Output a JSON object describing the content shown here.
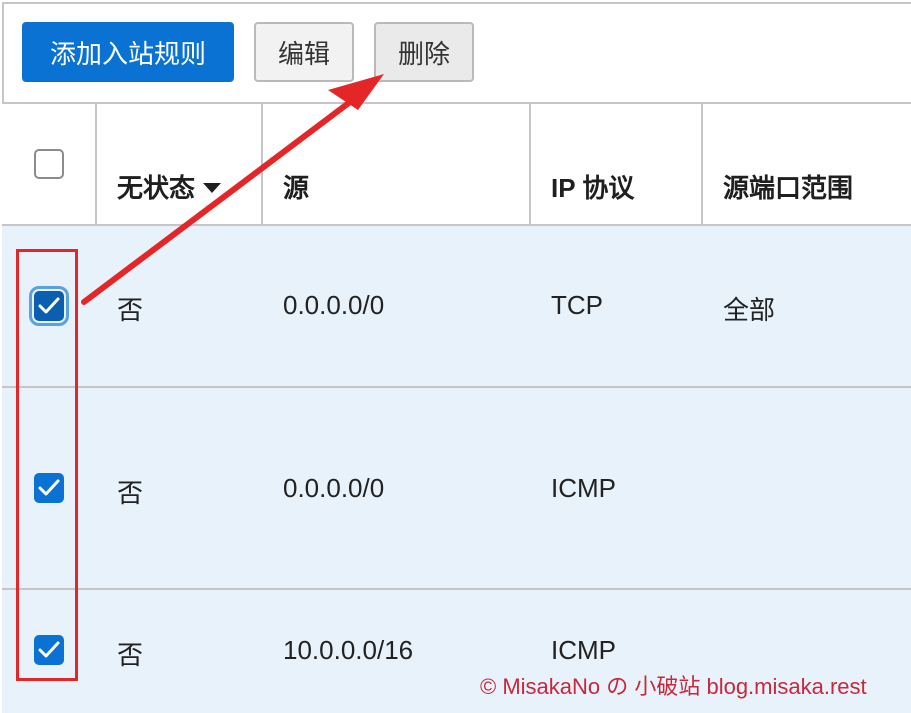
{
  "toolbar": {
    "add_rule_label": "添加入站规则",
    "edit_label": "编辑",
    "delete_label": "删除"
  },
  "table": {
    "columns": [
      "无状态",
      "源",
      "IP 协议",
      "源端口范围"
    ],
    "rows": [
      {
        "selected": true,
        "stateless": "否",
        "source": "0.0.0.0/0",
        "protocol": "TCP",
        "port_range": "全部"
      },
      {
        "selected": true,
        "stateless": "否",
        "source": "0.0.0.0/0",
        "protocol": "ICMP",
        "port_range": ""
      },
      {
        "selected": true,
        "stateless": "否",
        "source": "10.0.0.0/16",
        "protocol": "ICMP",
        "port_range": ""
      }
    ]
  },
  "icons": {
    "checkbox": "checkmark-icon",
    "sort": "caret-down-icon",
    "annotation": "red-arrow-annotation"
  },
  "colors": {
    "primary": "#0972d3",
    "row_selected": "#e8f2fa",
    "annotation": "#e52629",
    "watermark": "#c8283c"
  },
  "watermark": "© MisakaNo の 小破站 blog.misaka.rest"
}
